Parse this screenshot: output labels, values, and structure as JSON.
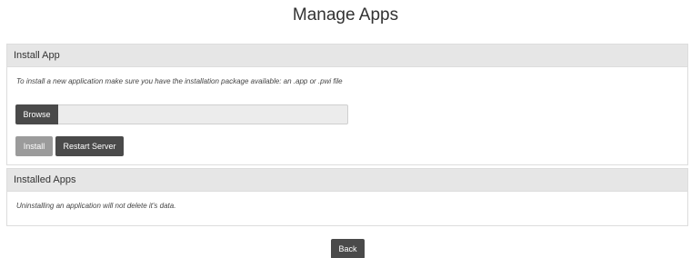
{
  "page": {
    "title": "Manage Apps"
  },
  "install_panel": {
    "heading": "Install App",
    "note": "To install a new application make sure you have the installation package available: an .app or .pwi file",
    "browse_label": "Browse",
    "file_value": "",
    "install_label": "Install",
    "restart_label": "Restart Server"
  },
  "installed_panel": {
    "heading": "Installed Apps",
    "note": "Uninstalling an application will not delete it's data."
  },
  "footer": {
    "back_label": "Back"
  },
  "colors": {
    "dark_button": "#4a4a4a",
    "disabled_button": "#9b9b9b",
    "panel_heading_bg": "#e6e6e6",
    "border": "#dddddd"
  }
}
